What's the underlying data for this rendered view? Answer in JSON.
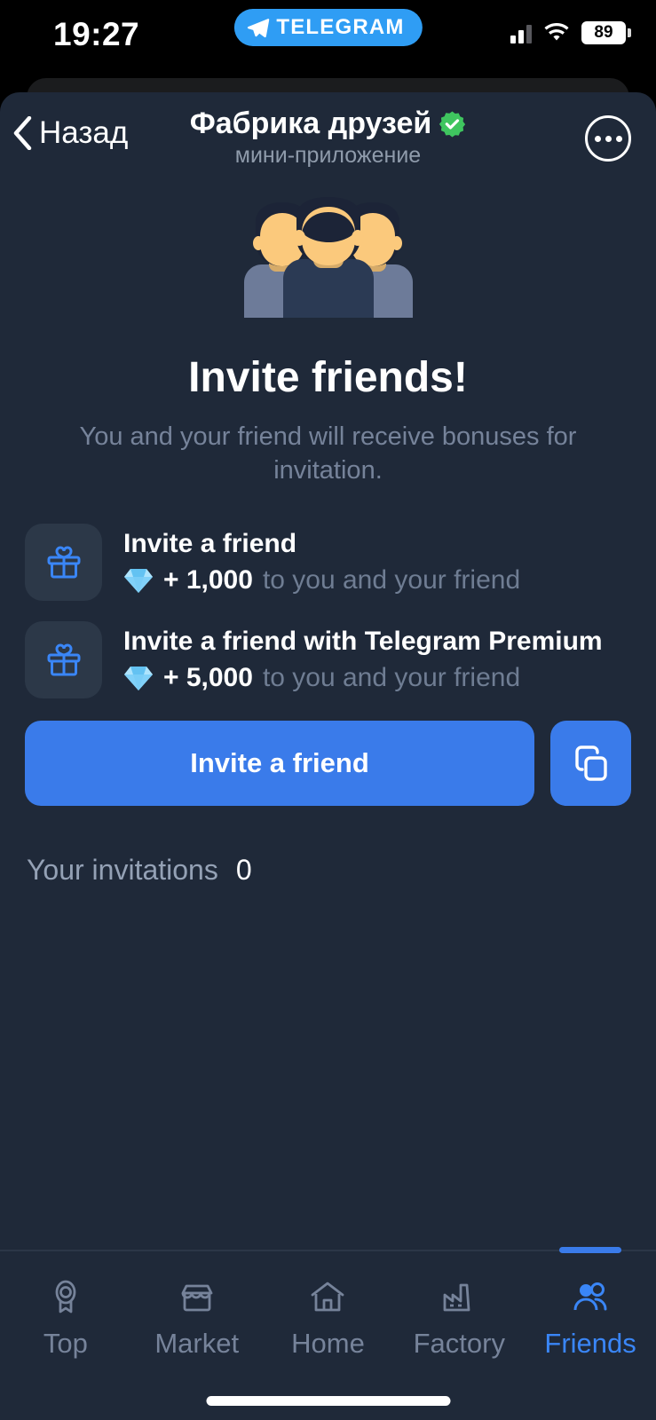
{
  "status_bar": {
    "time": "19:27",
    "app_pill_label": "TELEGRAM",
    "battery_percent": "89"
  },
  "header": {
    "back_label": "Назад",
    "title": "Фабрика друзей",
    "subtitle": "мини-приложение",
    "verified": true
  },
  "main": {
    "heading": "Invite friends!",
    "description": "You and your friend will receive bonuses for invitation.",
    "bonus_rows": [
      {
        "title": "Invite a friend",
        "amount": "+ 1,000",
        "suffix": "to you and your friend",
        "icon": "gift-icon",
        "currency_icon": "gem-icon"
      },
      {
        "title": "Invite a friend with Telegram Premium",
        "amount": "+ 5,000",
        "suffix": "to you and your friend",
        "icon": "gift-icon",
        "currency_icon": "gem-icon"
      }
    ],
    "cta_label": "Invite a friend",
    "copy_icon": "copy-icon",
    "invitations_label": "Your invitations",
    "invitations_count": "0"
  },
  "nav": {
    "items": [
      {
        "label": "Top",
        "icon": "award-icon",
        "active": false
      },
      {
        "label": "Market",
        "icon": "store-icon",
        "active": false
      },
      {
        "label": "Home",
        "icon": "house-icon",
        "active": false
      },
      {
        "label": "Factory",
        "icon": "factory-icon",
        "active": false
      },
      {
        "label": "Friends",
        "icon": "people-icon",
        "active": true
      }
    ]
  },
  "colors": {
    "accent": "#3a7bea",
    "accent_text": "#3a86f7",
    "sheet_bg": "#1f2939",
    "tile_bg": "#2c3848",
    "muted_text": "#76839a",
    "verified_green": "#3fc55f",
    "telegram_blue": "#2f9df4"
  }
}
